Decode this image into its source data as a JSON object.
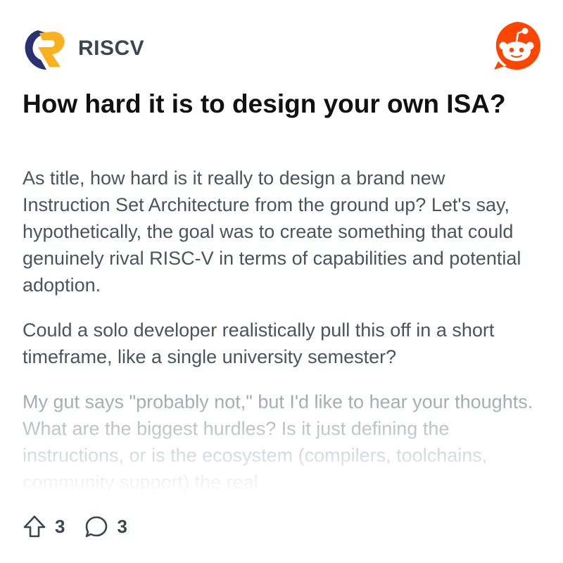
{
  "subreddit": {
    "name": "RISCV",
    "logo_icon": "riscv-logo-icon",
    "logo_colors": {
      "navy": "#283272",
      "gold": "#f9b21d"
    }
  },
  "app_logo_icon": "reddit-snoo-icon",
  "accent_color": "#ff4500",
  "post": {
    "title": "How hard it is to design your own ISA?",
    "paragraphs": [
      "As title, how hard is it really to design a brand new Instruction Set Architecture from the ground up? Let's say, hypothetically, the goal was to create something that could genuinely rival RISC-V in terms of capabilities and potential adoption.",
      "Could a solo developer realistically pull this off in a short timeframe, like a single university semester?",
      "My gut says \"probably not,\" but I'd like to hear your thoughts. What are the biggest hurdles? Is it just defining the instructions, or is the ecosystem (compilers, toolchains, community support) the real"
    ]
  },
  "footer": {
    "upvote_icon": "upvote-arrow-icon",
    "upvotes": "3",
    "comment_icon": "comment-bubble-icon",
    "comments": "3"
  }
}
